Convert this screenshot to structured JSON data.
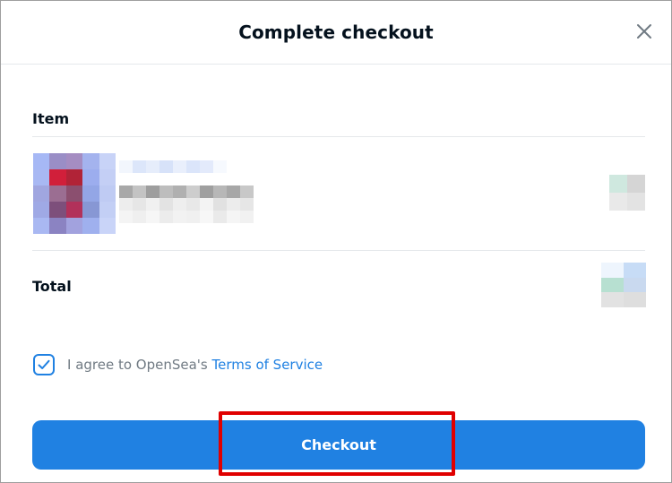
{
  "modal": {
    "title": "Complete checkout",
    "close_icon": "close-icon"
  },
  "item_section": {
    "label": "Item"
  },
  "total_section": {
    "label": "Total"
  },
  "agreement": {
    "checked": true,
    "prefix": "I agree to OpenSea's ",
    "link_text": "Terms of Service",
    "check_icon": "checkmark-icon"
  },
  "checkout": {
    "label": "Checkout"
  },
  "colors": {
    "accent": "#2081e2",
    "highlight": "#e00000",
    "text_dark": "#04111d",
    "text_muted": "#707a83"
  }
}
